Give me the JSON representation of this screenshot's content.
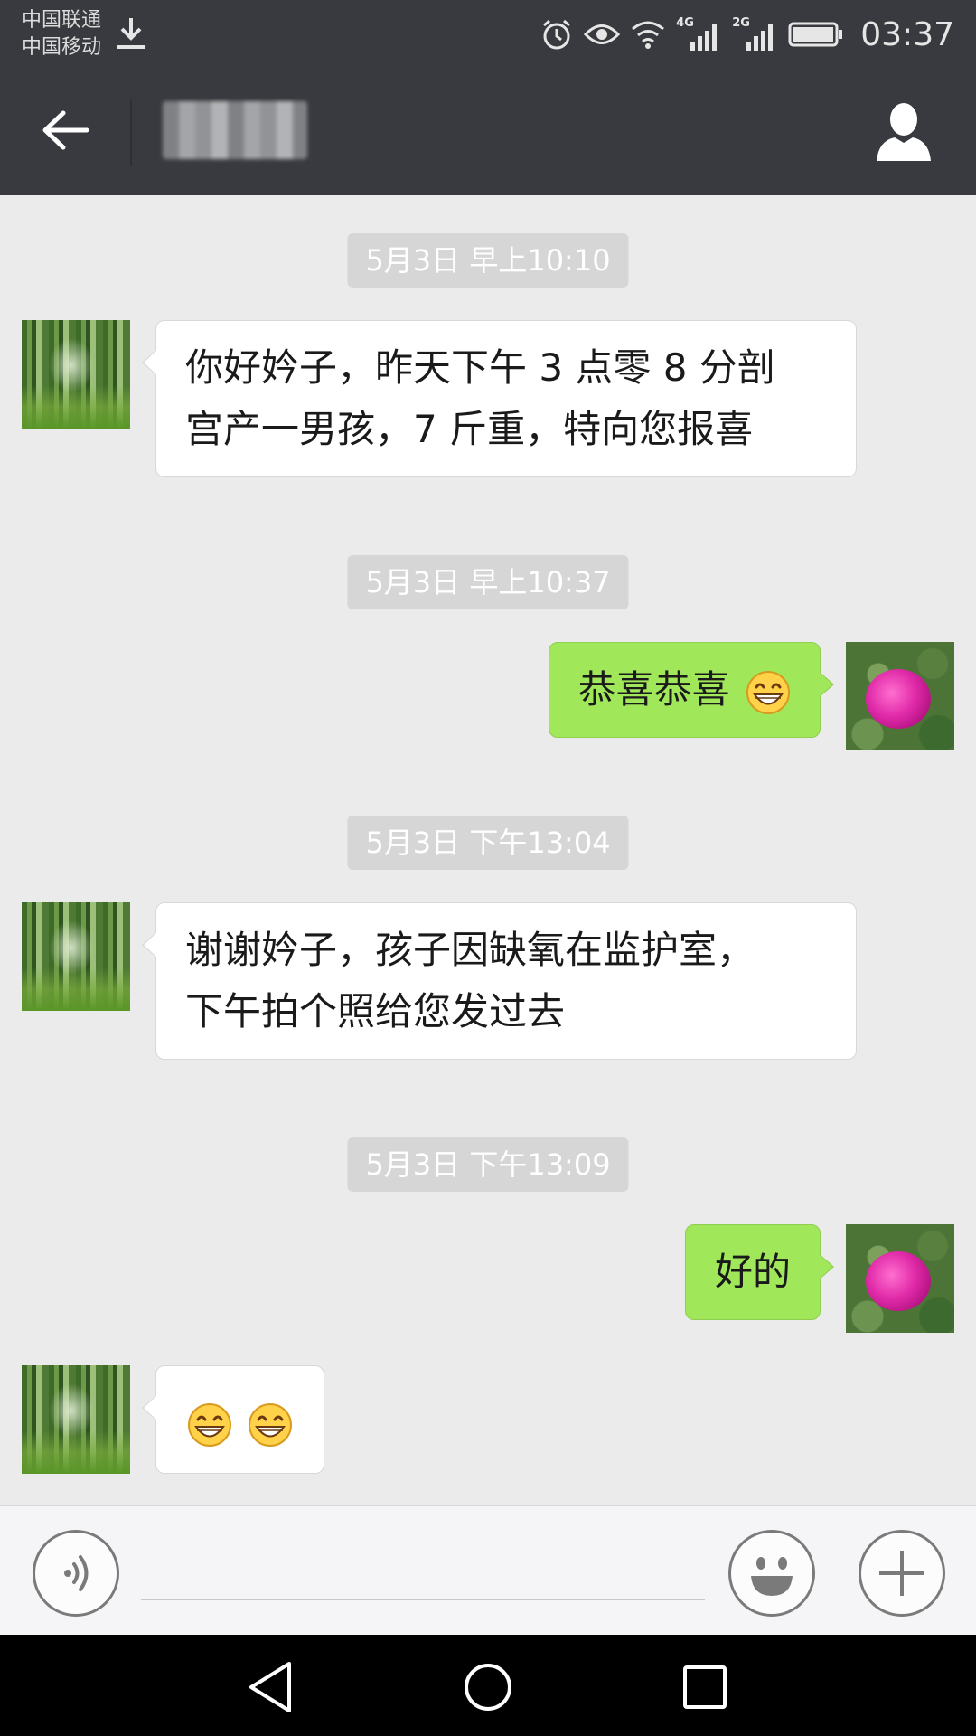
{
  "status_bar": {
    "carrier_1": "中国联通",
    "carrier_2": "中国移动",
    "network_1": "4G",
    "network_2": "2G",
    "time": "03:37"
  },
  "header": {
    "back_icon": "arrow-left-icon",
    "profile_icon": "person-icon"
  },
  "messages": [
    {
      "type": "timestamp",
      "text": "5月3日 早上10:10"
    },
    {
      "type": "incoming",
      "lines": [
        "你好妗子，昨天下午 3 点零 8 分剖",
        "宫产一男孩，7 斤重，特向您报喜"
      ]
    },
    {
      "type": "timestamp",
      "text": "5月3日 早上10:37"
    },
    {
      "type": "outgoing",
      "text": "恭喜恭喜",
      "emoji": "grin-emoji"
    },
    {
      "type": "timestamp",
      "text": "5月3日 下午13:04"
    },
    {
      "type": "incoming",
      "lines": [
        "谢谢妗子，孩子因缺氧在监护室，",
        "下午拍个照给您发过去"
      ]
    },
    {
      "type": "timestamp",
      "text": "5月3日 下午13:09"
    },
    {
      "type": "outgoing",
      "text": "好的"
    },
    {
      "type": "incoming_emoji",
      "emoji": [
        "grin-emoji",
        "grin-emoji"
      ]
    }
  ],
  "input_bar": {
    "voice_icon": "voice-icon",
    "emoji_icon": "smiley-icon",
    "plus_icon": "plus-icon",
    "text_value": ""
  },
  "colors": {
    "header_bg": "#393a3f",
    "chat_bg": "#ebebeb",
    "outgoing_bubble": "#a0e75a",
    "incoming_bubble": "#ffffff",
    "timestamp_bg": "#d6d6d6"
  }
}
